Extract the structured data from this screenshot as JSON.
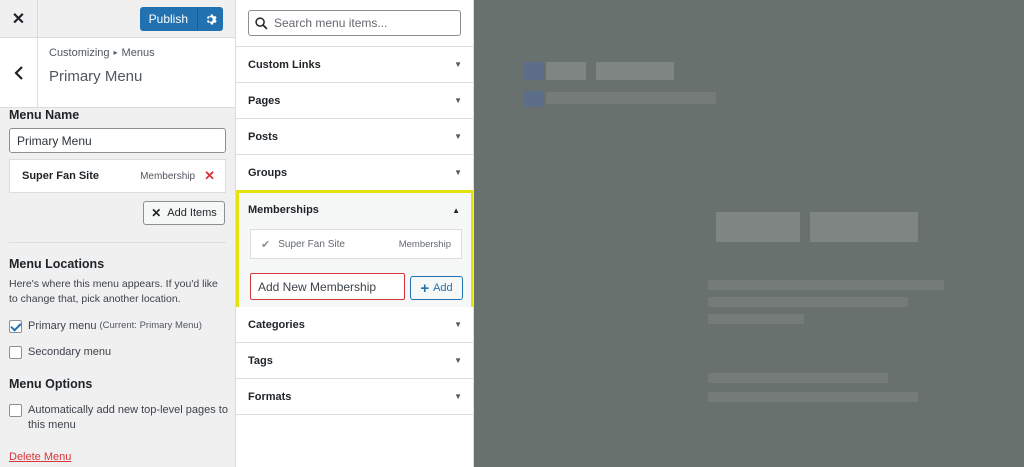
{
  "left_panel": {
    "close_icon": "close-icon",
    "publish_label": "Publish",
    "breadcrumb": {
      "root": "Customizing",
      "child": "Menus"
    },
    "title": "Primary Menu",
    "menu_name": {
      "label": "Menu Name",
      "value": "Primary Menu"
    },
    "menu_items": [
      {
        "name": "Super Fan Site",
        "type": "Membership"
      }
    ],
    "add_items_label": "Add Items",
    "locations": {
      "heading": "Menu Locations",
      "description": "Here's where this menu appears. If you'd like to change that, pick another location.",
      "options": [
        {
          "label": "Primary menu",
          "sub": "(Current: Primary Menu)",
          "checked": true
        },
        {
          "label": "Secondary menu",
          "sub": "",
          "checked": false
        }
      ]
    },
    "options": {
      "heading": "Menu Options",
      "auto_add_label": "Automatically add new top-level pages to this menu",
      "auto_add_checked": false
    },
    "delete_label": "Delete Menu"
  },
  "middle_panel": {
    "search_placeholder": "Search menu items...",
    "sections": [
      {
        "label": "Custom Links"
      },
      {
        "label": "Pages"
      },
      {
        "label": "Posts"
      },
      {
        "label": "Groups"
      }
    ],
    "memberships": {
      "label": "Memberships",
      "expanded": true,
      "item": {
        "name": "Super Fan Site",
        "type": "Membership"
      },
      "new_placeholder": "Add New Membership",
      "add_label": "Add"
    },
    "sections_after": [
      {
        "label": "Categories"
      },
      {
        "label": "Tags"
      },
      {
        "label": "Formats"
      }
    ]
  },
  "colors": {
    "accent": "#2271b1",
    "highlight": "#e4e20f",
    "danger": "#d63638",
    "preview_bg": "#68716e"
  }
}
